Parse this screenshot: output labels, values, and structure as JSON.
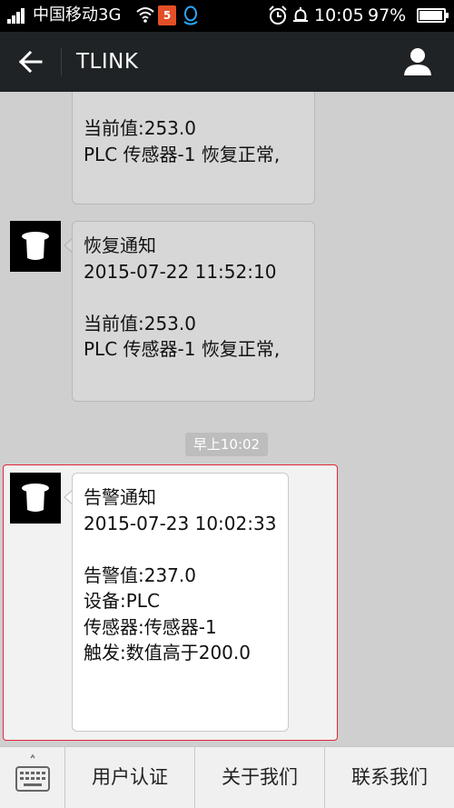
{
  "status_bar": {
    "carrier": "中国移动3G",
    "html5_badge": "5",
    "time": "10:05",
    "battery": "97%",
    "battery_level": 0.97,
    "icons": [
      "signal-icon",
      "wifi-icon",
      "html5-icon",
      "qq-icon",
      "alarm-icon",
      "do-not-disturb-icon",
      "battery-icon"
    ]
  },
  "titlebar": {
    "title": "TLINK",
    "icons": [
      "back-arrow-icon",
      "profile-icon"
    ]
  },
  "messages": [
    {
      "lines": [
        "当前值:253.0",
        "PLC 传感器-1 恢复正常,"
      ]
    },
    {
      "title": "恢复通知",
      "datetime": "2015-07-22 11:52:10",
      "value": "当前值:253.0",
      "status": "PLC 传感器-1 恢复正常,"
    },
    {
      "title": "告警通知",
      "datetime": "2015-07-23 10:02:33",
      "alarm_value": "告警值:237.0",
      "device": "设备:PLC",
      "sensor": "传感器:传感器-1",
      "trigger": "触发:数值高于200.0"
    }
  ],
  "timestamp": "早上10:02",
  "bottom_bar": {
    "keyboard_icon": "keyboard-icon",
    "menus": [
      "用户认证",
      "关于我们",
      "联系我们"
    ]
  },
  "colors": {
    "highlight_border": "#e0283a",
    "titlebar_bg": "#1f2326",
    "chat_bg": "#cfcfcf"
  }
}
